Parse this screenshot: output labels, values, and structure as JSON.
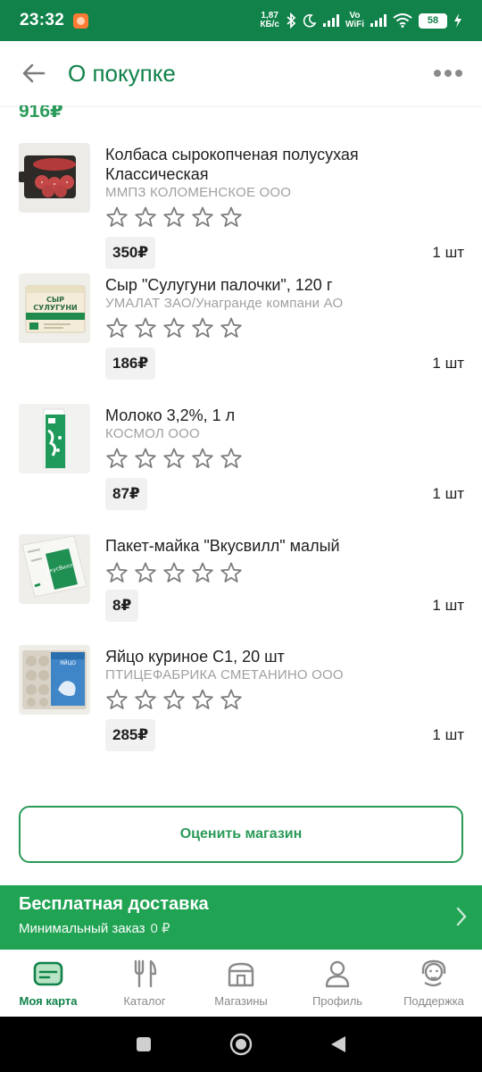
{
  "status_bar": {
    "time": "23:32",
    "net_speed_top": "1,87",
    "net_speed_bottom": "КБ/с",
    "vo_top": "Vo",
    "vo_bottom": "WiFi",
    "battery": "58",
    "icons": [
      "app-notification-icon",
      "bluetooth-icon",
      "moon-icon",
      "signal-icon",
      "wifi-icon",
      "battery-icon",
      "charging-icon"
    ]
  },
  "header": {
    "title": "О покупке",
    "back_icon": "arrow-left-icon",
    "menu_icon": "more-dots-icon"
  },
  "total_partial": "916₽",
  "items": [
    {
      "name": "Колбаса сырокопченая полусухая Классическая",
      "maker": "ММПЗ КОЛОМЕНСКОЕ ООО",
      "rating": 0,
      "max_rating": 5,
      "price": "350₽",
      "qty": "1 шт",
      "thumb": "sausage-thumb"
    },
    {
      "name": "Сыр \"Сулугуни палочки\", 120 г",
      "maker": "УМАЛАТ ЗАО/Унагранде компани АО",
      "rating": 0,
      "max_rating": 5,
      "price": "186₽",
      "qty": "1 шт",
      "thumb": "cheese-thumb",
      "thumb_text": "СЫР СУЛУГУНИ"
    },
    {
      "name": "Молоко 3,2%, 1 л",
      "maker": "КОСМОЛ ООО",
      "rating": 0,
      "max_rating": 5,
      "price": "87₽",
      "qty": "1 шт",
      "thumb": "milk-thumb"
    },
    {
      "name": "Пакет-майка \"Вкусвилл\" малый",
      "maker": "",
      "rating": 0,
      "max_rating": 5,
      "price": "8₽",
      "qty": "1 шт",
      "thumb": "bag-thumb"
    },
    {
      "name": "Яйцо куриное С1, 20 шт",
      "maker": "ПТИЦЕФАБРИКА СМЕТАНИНО ООО",
      "rating": 0,
      "max_rating": 5,
      "price": "285₽",
      "qty": "1 шт",
      "thumb": "eggs-thumb"
    }
  ],
  "rate_button": "Оценить магазин",
  "delivery": {
    "title": "Бесплатная доставка",
    "subtitle": "Минимальный заказ",
    "min_order": "0 ₽"
  },
  "bottom_nav": [
    {
      "label": "Моя карта",
      "icon": "card-icon",
      "active": true
    },
    {
      "label": "Каталог",
      "icon": "fork-knife-icon",
      "active": false
    },
    {
      "label": "Магазины",
      "icon": "store-icon",
      "active": false
    },
    {
      "label": "Профиль",
      "icon": "profile-icon",
      "active": false
    },
    {
      "label": "Поддержка",
      "icon": "support-icon",
      "active": false
    }
  ],
  "colors": {
    "brand_green": "#10824a",
    "accent_green": "#21a354",
    "price_bg": "#f1f1f1",
    "muted": "#a0a0a0"
  }
}
